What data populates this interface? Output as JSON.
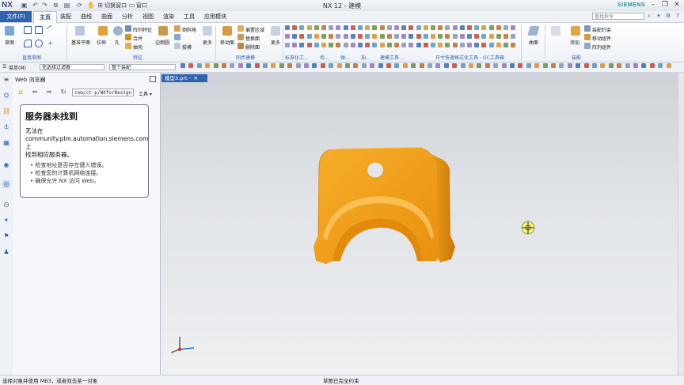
{
  "titlebar": {
    "logo": "NX",
    "switch_window": "切换窗口",
    "window_menu": "窗口",
    "title": "NX 12 - 建模",
    "brand": "SIEMENS"
  },
  "tabs": [
    {
      "label": "文件(F)"
    },
    {
      "label": "主页"
    },
    {
      "label": "装配"
    },
    {
      "label": "曲线"
    },
    {
      "label": "曲面"
    },
    {
      "label": "分析"
    },
    {
      "label": "视图"
    },
    {
      "label": "渲染"
    },
    {
      "label": "工具"
    },
    {
      "label": "应用模块"
    }
  ],
  "search_placeholder": "查找命令",
  "ribbon": {
    "sketch": "草图",
    "datum_plane": "基准平面",
    "extrude": "拉伸",
    "hole": "孔",
    "pattern_feature": "阵列特征",
    "unite": "合并",
    "shell": "抽壳",
    "edge_blend": "边倒圆",
    "chamfer": "倒斜角",
    "draft": "拔模",
    "more1": "更多",
    "move_face": "移动面",
    "offset_region": "偏置区域",
    "replace_face": "替换面",
    "delete_face": "删除面",
    "more2": "更多",
    "surface": "曲面",
    "add": "添加",
    "assembly_constraint": "装配约束",
    "move_component": "移动组件",
    "pattern_component": "阵列组件",
    "groups": {
      "direct_sketch": "直接草图",
      "feature": "特征",
      "sync_model": "同步建模",
      "standardize": "标准化工...",
      "gear": "齿...",
      "spring": "弹...",
      "machining": "加...",
      "modeling_tools": "建模工具 ...",
      "dimension": "尺寸快速格式化工具 - GC工具箱",
      "assembly": "装配"
    }
  },
  "toolbar": {
    "menu": "菜单(M)",
    "selection_filter": "无选择过滤器",
    "assembly_scope": "整个装配"
  },
  "browser": {
    "title": "Web 浏览器",
    "url": "com/ct-p/NXforDesign",
    "tools": "工具",
    "error_title": "服务器未找到",
    "error_line1": "无法在",
    "error_line2": "community.plm.automation.siemens.com 上",
    "error_line3": "找到相应服务器。",
    "bullets": [
      "检查地址是否存在键入错误。",
      "检查您的计算机网络连接。",
      "确保允许 NX 访问 Web。"
    ]
  },
  "viewport": {
    "tab_label": "模型3.prt"
  },
  "statusbar": {
    "left": "选择对象并使用 MB3，或者双击某一对象",
    "middle": "草图已完全约束"
  },
  "colors": {
    "accent": "#2f63b0",
    "part": "#f5a21c",
    "brand": "#2c8e99"
  }
}
